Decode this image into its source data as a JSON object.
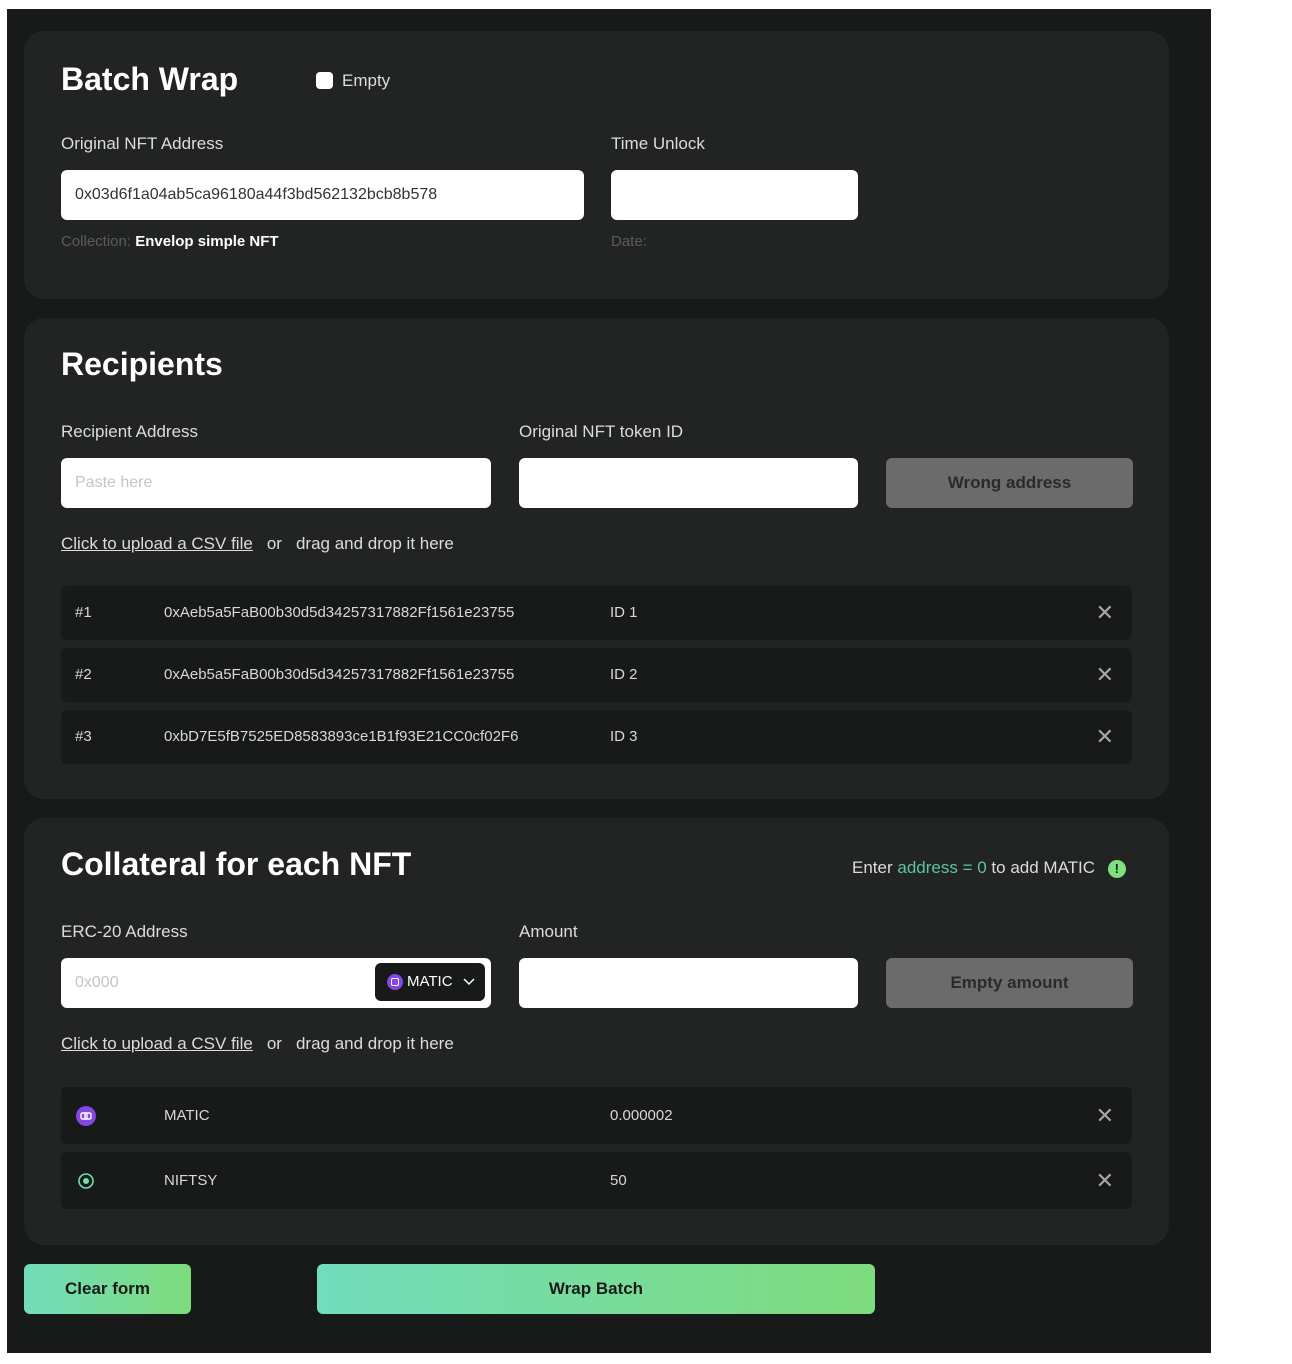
{
  "wrap": {
    "title": "Batch Wrap",
    "empty_label": "Empty",
    "nft_label": "Original NFT Address",
    "nft_value": "0x03d6f1a04ab5ca96180a44f3bd562132bcb8b578",
    "collection_prefix": "Collection:",
    "collection_name": "Envelop simple NFT",
    "time_label": "Time Unlock",
    "time_value": "",
    "date_prefix": "Date:"
  },
  "recipients": {
    "title": "Recipients",
    "address_label": "Recipient Address",
    "address_placeholder": "Paste here",
    "token_label": "Original NFT token ID",
    "token_value": "",
    "wrong_button": "Wrong address",
    "upload_link": "Click to upload a CSV file",
    "upload_or": "or",
    "upload_drag": "drag and drop it here",
    "rows": [
      {
        "num": "#1",
        "address": "0xAeb5a5FaB00b30d5d34257317882Ff1561e23755",
        "id": "ID 1"
      },
      {
        "num": "#2",
        "address": "0xAeb5a5FaB00b30d5d34257317882Ff1561e23755",
        "id": "ID 2"
      },
      {
        "num": "#3",
        "address": "0xbD7E5fB7525ED8583893ce1B1f93E21CC0cf02F6",
        "id": "ID 3"
      }
    ]
  },
  "collateral": {
    "title": "Collateral for each NFT",
    "hint_pre": "Enter",
    "hint_acc": "address = 0",
    "hint_post": "to add MATIC",
    "info_glyph": "!",
    "erc_label": "ERC-20 Address",
    "erc_placeholder": "0x000",
    "token_select": "MATIC",
    "amount_label": "Amount",
    "amount_value": "",
    "empty_button": "Empty amount",
    "upload_link": "Click to upload a CSV file",
    "upload_or": "or",
    "upload_drag": "drag and drop it here",
    "rows": [
      {
        "icon": "matic-icon",
        "token": "MATIC",
        "amount": "0.000002"
      },
      {
        "icon": "niftsy-icon",
        "token": "NIFTSY",
        "amount": "50"
      }
    ]
  },
  "actions": {
    "clear": "Clear form",
    "wrap": "Wrap Batch"
  },
  "remove_glyph": "✕",
  "colors": {
    "accent": "#5ec3a1",
    "matic": "#8247e5",
    "gradient_start": "#72dcbc",
    "gradient_end": "#7ddc7c"
  }
}
